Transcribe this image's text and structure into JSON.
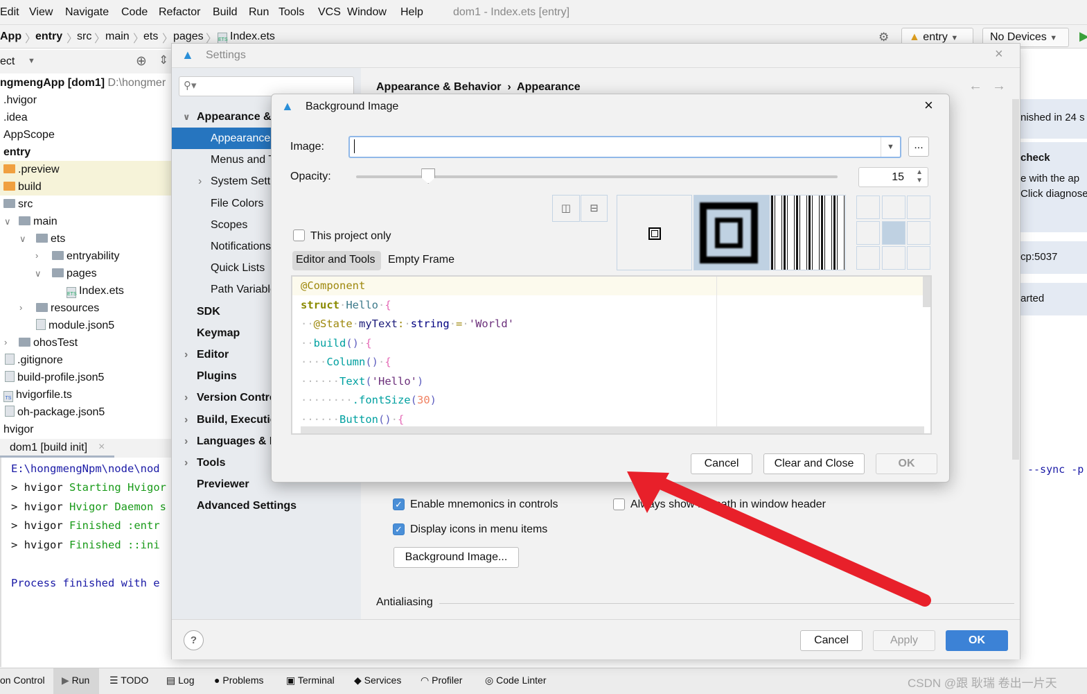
{
  "menu": {
    "items": [
      "Edit",
      "View",
      "Navigate",
      "Code",
      "Refactor",
      "Build",
      "Run",
      "Tools",
      "VCS",
      "Window",
      "Help"
    ],
    "window_title": "dom1 - Index.ets [entry]"
  },
  "breadcrumb": {
    "items": [
      "App",
      "entry",
      "src",
      "main",
      "ets",
      "pages",
      "Index.ets"
    ]
  },
  "toolbar": {
    "module": "entry",
    "device": "No Devices"
  },
  "project": {
    "header": "ect",
    "root": "ngmengApp [dom1]",
    "root_path": "D:\\hongmer",
    "items": [
      ".hvigor",
      ".idea",
      "AppScope",
      "entry",
      ".preview",
      "build",
      "src",
      "main",
      "ets",
      "entryability",
      "pages",
      "Index.ets",
      "resources",
      "module.json5",
      "ohosTest",
      ".gitignore",
      "build-profile.json5",
      "hvigorfile.ts",
      "oh-package.json5",
      "hvigor"
    ]
  },
  "run": {
    "tab": "dom1 [build init]",
    "lines": [
      {
        "prefix": "E:\\hongmengNpm\\node\\nod",
        "text": ""
      },
      {
        "prefix": "> hvigor ",
        "text": "Starting Hvigor"
      },
      {
        "prefix": "> hvigor ",
        "text": "Hvigor Daemon s"
      },
      {
        "prefix": "> hvigor ",
        "text": "Finished :entr"
      },
      {
        "prefix": "> hvigor ",
        "text": "Finished ::ini"
      },
      {
        "prefix": "Process finished with e",
        "text": ""
      }
    ],
    "tail": "--sync -p"
  },
  "notifications": [
    "nished in 24 s",
    "check",
    "e with the ap",
    "Click diagnose",
    "cp:5037",
    "arted"
  ],
  "bottom_tabs": [
    "on Control",
    "Run",
    "TODO",
    "Log",
    "Problems",
    "Terminal",
    "Services",
    "Profiler",
    "Code Linter"
  ],
  "watermark": "CSDN @跟 耿瑞 卷出一片天",
  "settings": {
    "title": "Settings",
    "breadcrumb": [
      "Appearance & Behavior",
      "Appearance"
    ],
    "nav": [
      "Appearance & Behavior",
      "Appearance",
      "Menus and Toolbars",
      "System Settings",
      "File Colors",
      "Scopes",
      "Notifications",
      "Quick Lists",
      "Path Variables",
      "SDK",
      "Keymap",
      "Editor",
      "Plugins",
      "Version Control",
      "Build, Execution, Deployment",
      "Languages & Frameworks",
      "Tools",
      "Previewer",
      "Advanced Settings"
    ],
    "options": {
      "enable_mnemonics": {
        "label": "Enable mnemonics in controls",
        "checked": true
      },
      "always_show_path": {
        "label": "Always show full path in window header",
        "checked": false
      },
      "display_icons": {
        "label": "Display icons in menu items",
        "checked": true
      }
    },
    "background_image_button": "Background Image...",
    "antialiasing": "Antialiasing",
    "help": "?",
    "buttons": {
      "cancel": "Cancel",
      "apply": "Apply",
      "ok": "OK"
    }
  },
  "bg_dialog": {
    "title": "Background Image",
    "image_label": "Image:",
    "image_value": "",
    "browse": "...",
    "opacity_label": "Opacity:",
    "opacity": 15,
    "this_project_only": {
      "label": "This project only",
      "checked": false
    },
    "tabs": [
      "Editor and Tools",
      "Empty Frame"
    ],
    "active_tab": "Editor and Tools",
    "fill_mode": "scale",
    "anchor": "center",
    "code": [
      [
        [
          "@Component",
          "ann"
        ]
      ],
      [
        [
          "struct",
          "kw"
        ],
        [
          "·",
          "dot"
        ],
        [
          "Hello",
          "id"
        ],
        [
          "·",
          "dot"
        ],
        [
          "{",
          "br"
        ]
      ],
      [
        [
          "··",
          "dot"
        ],
        [
          "@State",
          "ann"
        ],
        [
          "·",
          "dot"
        ],
        [
          "myText",
          "var"
        ],
        [
          ":",
          "ann"
        ],
        [
          "·",
          "dot"
        ],
        [
          "string",
          "type"
        ],
        [
          "·",
          "dot"
        ],
        [
          "=",
          "ann"
        ],
        [
          "·",
          "dot"
        ],
        [
          "'World'",
          "str"
        ]
      ],
      [
        [
          "··",
          "dot"
        ],
        [
          "build",
          "fn"
        ],
        [
          "()",
          "p"
        ],
        [
          "·",
          "dot"
        ],
        [
          "{",
          "br"
        ]
      ],
      [
        [
          "····",
          "dot"
        ],
        [
          "Column",
          "fn"
        ],
        [
          "()",
          "p"
        ],
        [
          "·",
          "dot"
        ],
        [
          "{",
          "br"
        ]
      ],
      [
        [
          "······",
          "dot"
        ],
        [
          "Text",
          "fn"
        ],
        [
          "(",
          "p"
        ],
        [
          "'Hello'",
          "str"
        ],
        [
          ")",
          "p"
        ]
      ],
      [
        [
          "········",
          "dot"
        ],
        [
          ".fontSize",
          "fn"
        ],
        [
          "(",
          "p"
        ],
        [
          "30",
          "num"
        ],
        [
          ")",
          "p"
        ]
      ],
      [
        [
          "······",
          "dot"
        ],
        [
          "Button",
          "fn"
        ],
        [
          "()",
          "p"
        ],
        [
          "·",
          "dot"
        ],
        [
          "{",
          "br"
        ]
      ]
    ],
    "buttons": {
      "cancel": "Cancel",
      "clear_close": "Clear and Close",
      "ok": "OK"
    }
  },
  "colors": {
    "selection": "#2675bf",
    "primary_button": "#3c82d6",
    "arrow": "#e8202a"
  }
}
